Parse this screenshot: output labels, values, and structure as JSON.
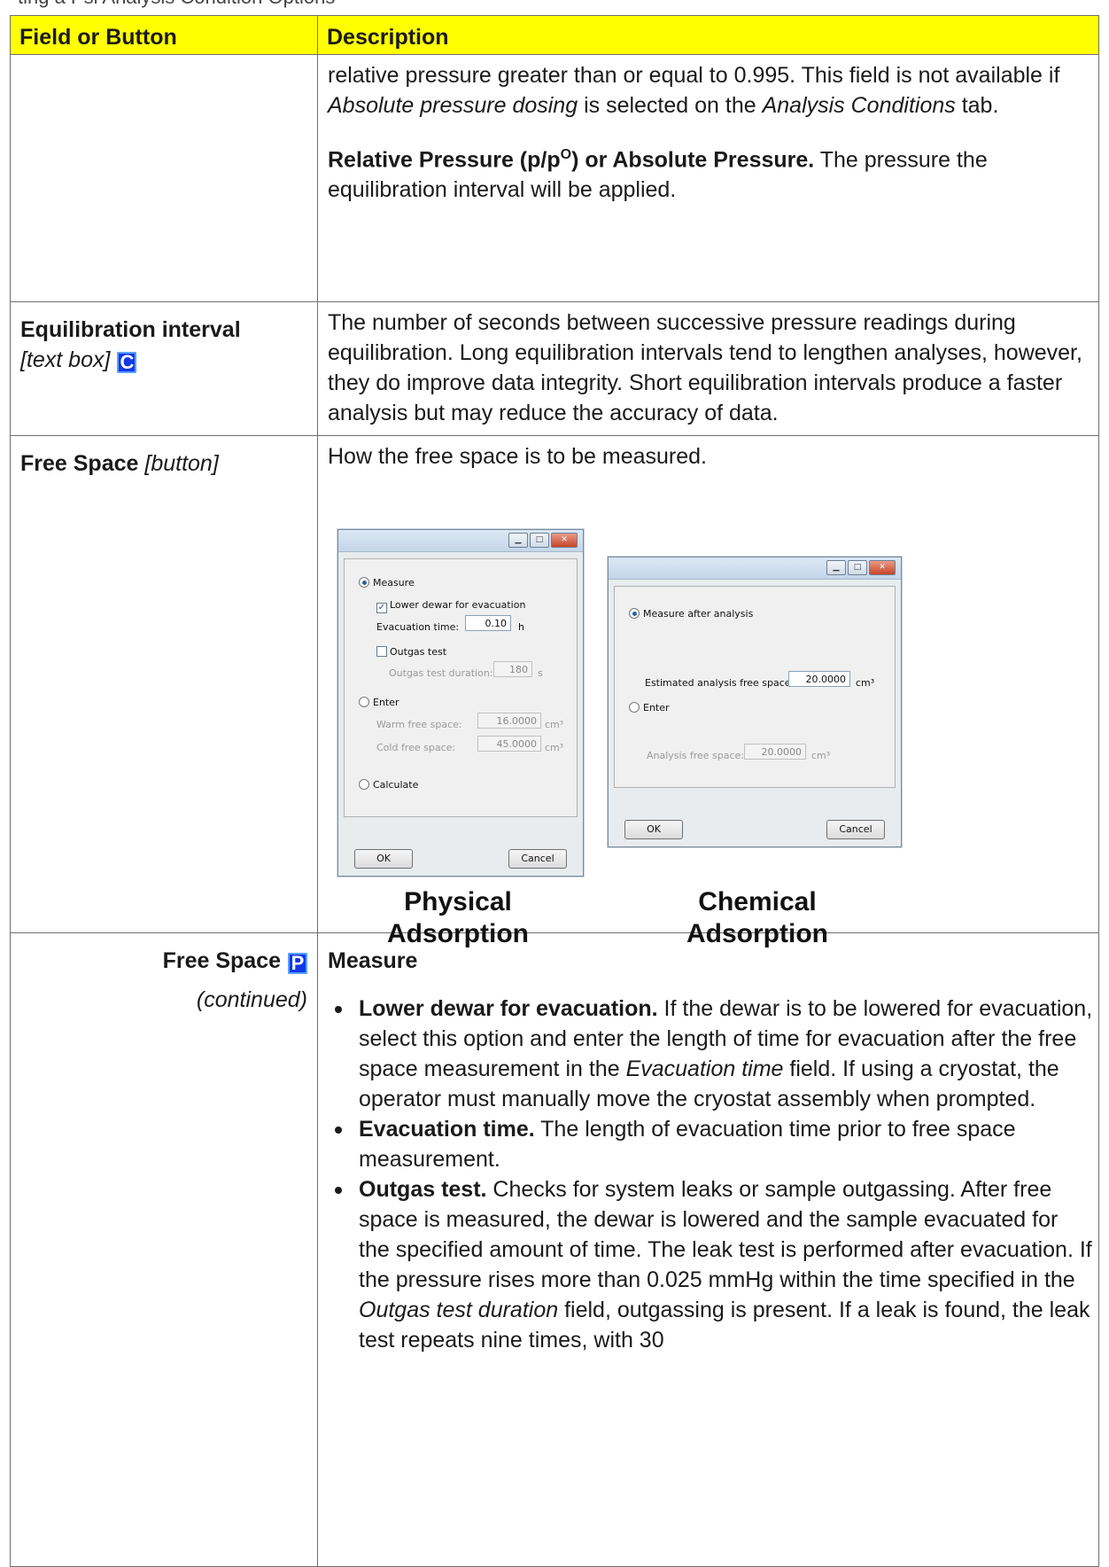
{
  "header": {
    "top_clip_text": "ting a Psi Analysis Condition  Options"
  },
  "table": {
    "col1_header": "Field or Button",
    "col2_header": "Description",
    "row1": {
      "p1_a": "relative pressure greater than or equal to 0.995. This field is not available if ",
      "p1_b": "Absolute pressure dosing",
      "p1_c": " is selected on the ",
      "p1_d": "Analysis Conditions",
      "p1_e": " tab.",
      "p2_bold_a": "Relative Pressure (p/p",
      "p2_bold_sup": "O",
      "p2_bold_b": ") or Absolute Pressure.",
      "p2_rest": " The pressure the equilibration interval will be applied."
    },
    "row2": {
      "field": "Equilibration interval",
      "field_type": "[text box]",
      "badge": "C",
      "description": "The number of seconds between successive pressure readings during equilibration. Long equilibration intervals tend to lengthen analyses, however, they do improve data integrity. Short equilibration intervals produce a faster analysis but may reduce the accuracy of data."
    },
    "row3": {
      "field": "Free Space",
      "field_type": "[button]",
      "description": "How the free space is to be measured.",
      "caption_left_1": "Physical",
      "caption_left_2": "Adsorption",
      "caption_right_1": "Chemical",
      "caption_right_2": "Adsorption"
    },
    "row4": {
      "field": "Free Space",
      "badge": "P",
      "continued": "(continued)",
      "heading": "Measure",
      "b1_bold": "Lower dewar for evacuation.",
      "b1_text_a": " If the dewar is to be lowered for evacuation, select this option and enter the length of time for evacuation after the free space measurement in the ",
      "b1_ital": "Evacuation time",
      "b1_text_b": " field. If using a cryostat, the operator must manually move the cryostat assembly when prompted.",
      "b2_bold": "Evacuation time.",
      "b2_text": " The length of evacuation time prior to free space measurement.",
      "b3_bold": "Outgas test.",
      "b3_text_a": " Checks for system leaks or sample outgassing. After free space is measured, the dewar is lowered and the sample evacuated for the specified amount of time. The leak test is performed after evacuation. If the pressure rises more than 0.025 mmHg within the time specified in the ",
      "b3_ital": "Outgas test duration",
      "b3_text_b": " field, outgassing is present. If a leak is found, the leak test repeats nine times, with 30"
    }
  },
  "dialog_physical": {
    "measure": "Measure",
    "lower_dewar": "Lower dewar for evacuation",
    "evac_label": "Evacuation time:",
    "evac_value": "0.10",
    "evac_unit": "h",
    "outgas": "Outgas test",
    "outgas_dur_label": "Outgas test duration:",
    "outgas_dur_value": "180",
    "outgas_dur_unit": "s",
    "enter": "Enter",
    "warm_label": "Warm free space:",
    "warm_value": "16.0000",
    "cold_label": "Cold free space:",
    "cold_value": "45.0000",
    "unit_cm3": "cm³",
    "calculate": "Calculate",
    "ok": "OK",
    "cancel": "Cancel"
  },
  "dialog_chemical": {
    "measure_after": "Measure after analysis",
    "est_label": "Estimated analysis free space:",
    "est_value": "20.0000",
    "enter": "Enter",
    "afs_label": "Analysis free space:",
    "afs_value": "20.0000",
    "unit_cm3": "cm³",
    "ok": "OK",
    "cancel": "Cancel"
  }
}
